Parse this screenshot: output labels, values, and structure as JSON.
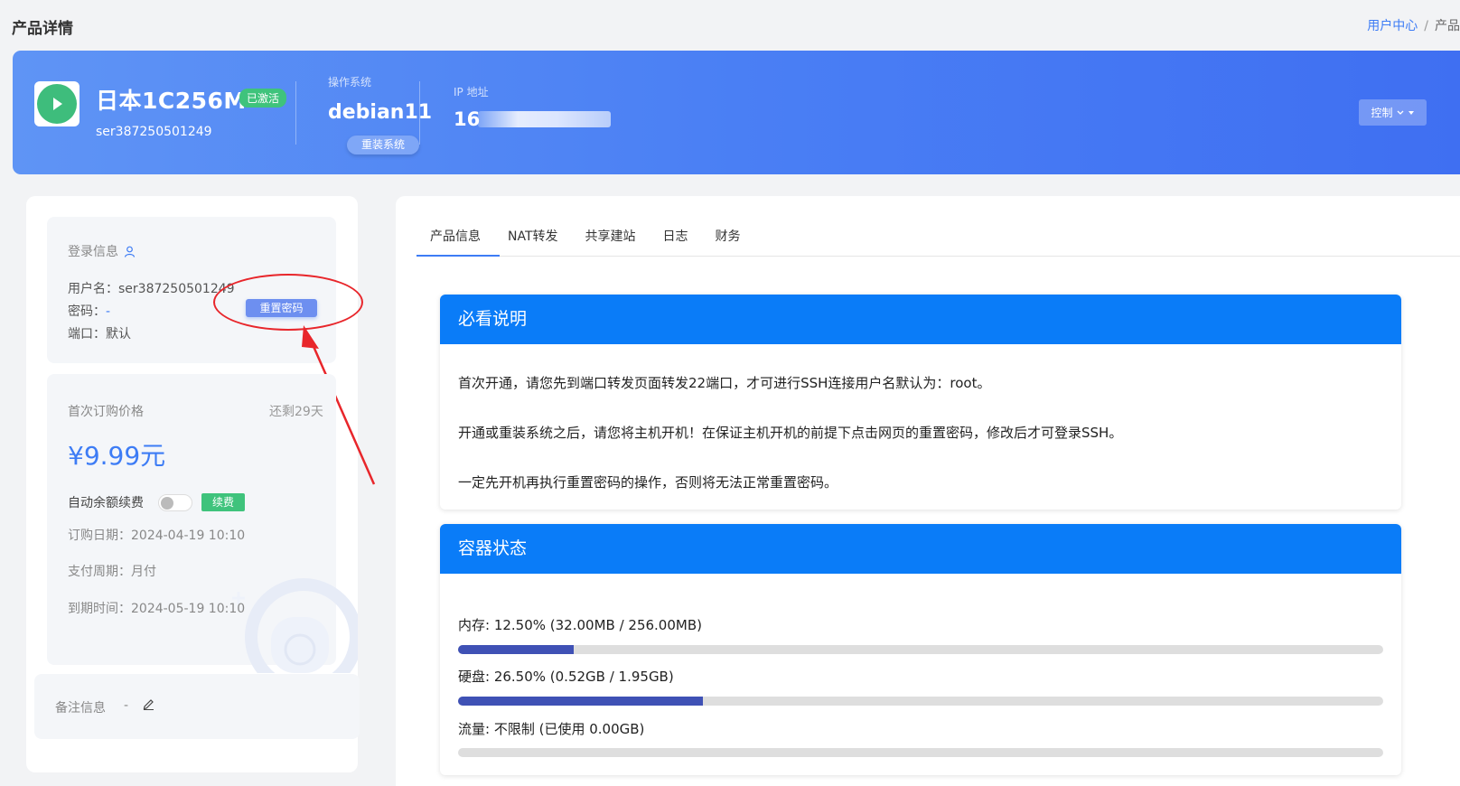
{
  "page": {
    "title": "产品详情"
  },
  "breadcrumb": {
    "home": "用户中心",
    "sep": "/",
    "current": "产品"
  },
  "product": {
    "name": "日本1C256M",
    "status": "已激活",
    "id": "ser387250501249",
    "os_label": "操作系统",
    "os": "debian11",
    "reinstall_label": "重装系统",
    "ip_label": "IP 地址",
    "ip_visible": "16",
    "control_label": "控制"
  },
  "login": {
    "title": "登录信息",
    "username_label": "用户名：",
    "username": "ser387250501249",
    "password_label": "密码：",
    "password": "-",
    "port_label": "端口：",
    "port": "默认",
    "reset_password_label": "重置密码"
  },
  "billing": {
    "first_price_label": "首次订购价格",
    "remaining": "还剩29天",
    "price": "¥9.99元",
    "auto_renew_label": "自动余额续费",
    "auto_renew_on": false,
    "renew_label": "续费",
    "order_date": "订购日期：2024-04-19 10:10",
    "pay_cycle": "支付周期：月付",
    "expire": "到期时间：2024-05-19 10:10"
  },
  "note": {
    "label": "备注信息",
    "value": "-"
  },
  "tabs": [
    "产品信息",
    "NAT转发",
    "共享建站",
    "日志",
    "财务"
  ],
  "notice": {
    "title": "必看说明",
    "lines": [
      "首次开通，请您先到端口转发页面转发22端口，才可进行SSH连接用户名默认为：root。",
      "开通或重装系统之后，请您将主机开机！在保证主机开机的前提下点击网页的重置密码，修改后才可登录SSH。",
      "一定先开机再执行重置密码的操作，否则将无法正常重置密码。"
    ]
  },
  "container": {
    "title": "容器状态",
    "memory": {
      "label": "内存: 12.50% (32.00MB / 256.00MB)",
      "percent": 12.5
    },
    "disk": {
      "label": "硬盘: 26.50% (0.52GB / 1.95GB)",
      "percent": 26.5
    },
    "traffic": {
      "label": "流量: 不限制 (已使用 0.00GB)",
      "percent": 0
    }
  },
  "colors": {
    "accent": "#3d7cf5",
    "panel_head": "#0a7cf8",
    "success": "#3fc37c",
    "progress": "#3f51b5",
    "annotation": "#e8262b"
  }
}
